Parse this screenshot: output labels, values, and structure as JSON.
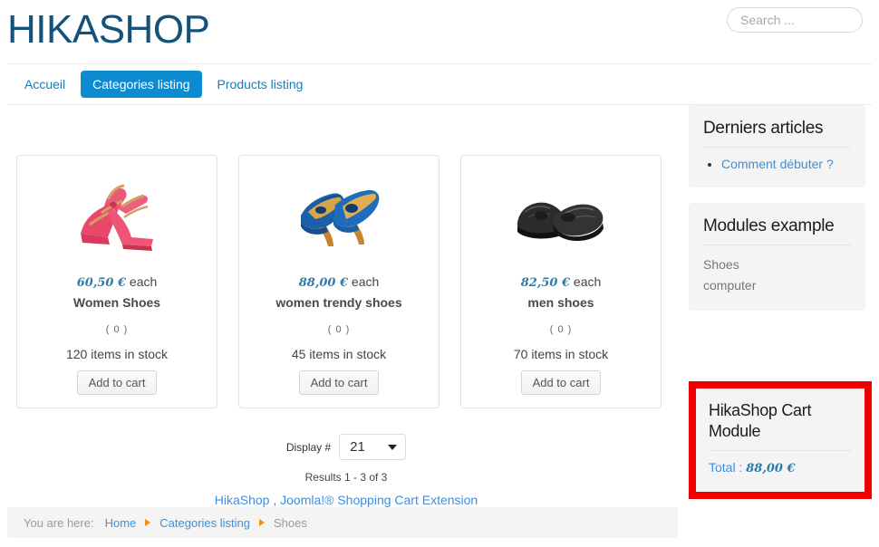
{
  "header": {
    "logo": "HIKASHOP",
    "search_placeholder": "Search ...",
    "search_value": ""
  },
  "nav": {
    "items": [
      {
        "label": "Accueil",
        "active": false
      },
      {
        "label": "Categories listing",
        "active": true
      },
      {
        "label": "Products listing",
        "active": false
      }
    ]
  },
  "products": [
    {
      "price": "60,50 €",
      "price_suffix": "each",
      "name": "Women Shoes",
      "rating": "( 0 )",
      "stock": "120 items in stock",
      "button": "Add to cart",
      "image": "red-sandals-photo"
    },
    {
      "price": "88,00 €",
      "price_suffix": "each",
      "name": "women trendy shoes",
      "rating": "( 0 )",
      "stock": "45 items in stock",
      "button": "Add to cart",
      "image": "blue-heels-photo"
    },
    {
      "price": "82,50 €",
      "price_suffix": "each",
      "name": "men shoes",
      "rating": "( 0 )",
      "stock": "70 items in stock",
      "button": "Add to cart",
      "image": "black-dress-shoes-photo"
    }
  ],
  "listing": {
    "display_label": "Display #",
    "display_value": "21",
    "results": "Results 1 - 3 of 3",
    "footer_link": "HikaShop , Joomla!® Shopping Cart Extension"
  },
  "sidebar": {
    "latest_articles": {
      "title": "Derniers articles",
      "items": [
        "Comment débuter ?"
      ]
    },
    "modules_example": {
      "title": "Modules example",
      "lines": [
        "Shoes",
        "computer"
      ]
    },
    "cart_module": {
      "title": "HikaShop Cart Module",
      "total_label": "Total :",
      "total_value": "88,00 €",
      "highlight_color": "#ee0000"
    }
  },
  "breadcrumb": {
    "label": "You are here:",
    "items": [
      {
        "text": "Home",
        "link": true
      },
      {
        "text": "Categories listing",
        "link": true
      },
      {
        "text": "Shoes",
        "link": false
      }
    ]
  },
  "colors": {
    "brand_dark_blue": "#14527a",
    "accent_blue": "#0d8bd1",
    "link_blue": "#3e8fdd",
    "price_blue": "#2d7ca8",
    "module_bg": "#f4f4f4",
    "breadcrumb_arrow": "#f5900c"
  }
}
